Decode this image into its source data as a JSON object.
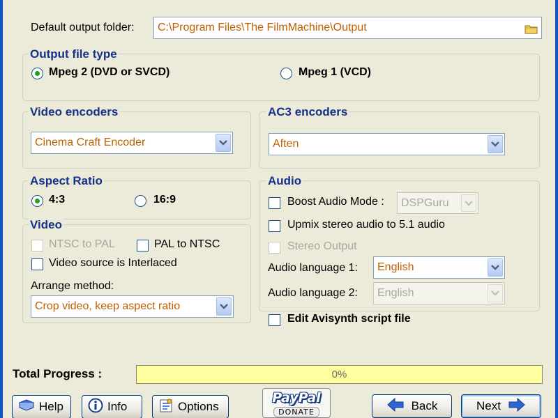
{
  "output_folder": {
    "label": "Default output folder:",
    "value": "C:\\Program Files\\The FilmMachine\\Output"
  },
  "output_file_type": {
    "title": "Output file type",
    "options": [
      "Mpeg 2 (DVD or SVCD)",
      "Mpeg 1 (VCD)"
    ],
    "selected": "Mpeg 2 (DVD or SVCD)"
  },
  "video_encoders": {
    "title": "Video encoders",
    "value": "Cinema Craft Encoder"
  },
  "ac3_encoders": {
    "title": "AC3 encoders",
    "value": "Aften"
  },
  "aspect_ratio": {
    "title": "Aspect Ratio",
    "options": [
      "4:3",
      "16:9"
    ],
    "selected": "4:3"
  },
  "video": {
    "title": "Video",
    "ntsc_to_pal": "NTSC to PAL",
    "pal_to_ntsc": "PAL to NTSC",
    "interlaced": "Video source is Interlaced",
    "arrange_label": "Arrange method:",
    "arrange_value": "Crop video,  keep aspect ratio"
  },
  "audio": {
    "title": "Audio",
    "boost_label": "Boost Audio Mode :",
    "boost_value": "DSPGuru",
    "upmix_label": "Upmix stereo audio to 5.1 audio",
    "stereo_label": "Stereo Output",
    "lang1_label": "Audio language 1:",
    "lang1_value": "English",
    "lang2_label": "Audio language 2:",
    "lang2_value": "English"
  },
  "avisynth_label": "Edit Avisynth script file",
  "progress": {
    "label": "Total Progress :",
    "text": "0%",
    "value": 0
  },
  "buttons": {
    "help": "Help",
    "info": "Info",
    "options": "Options",
    "back": "Back",
    "next": "Next"
  },
  "paypal": {
    "logo": "PayPal",
    "donate": "DONATE"
  },
  "colors": {
    "accent": "#15328c",
    "field_text": "#c06000",
    "progress_bg": "#ffffa0"
  }
}
